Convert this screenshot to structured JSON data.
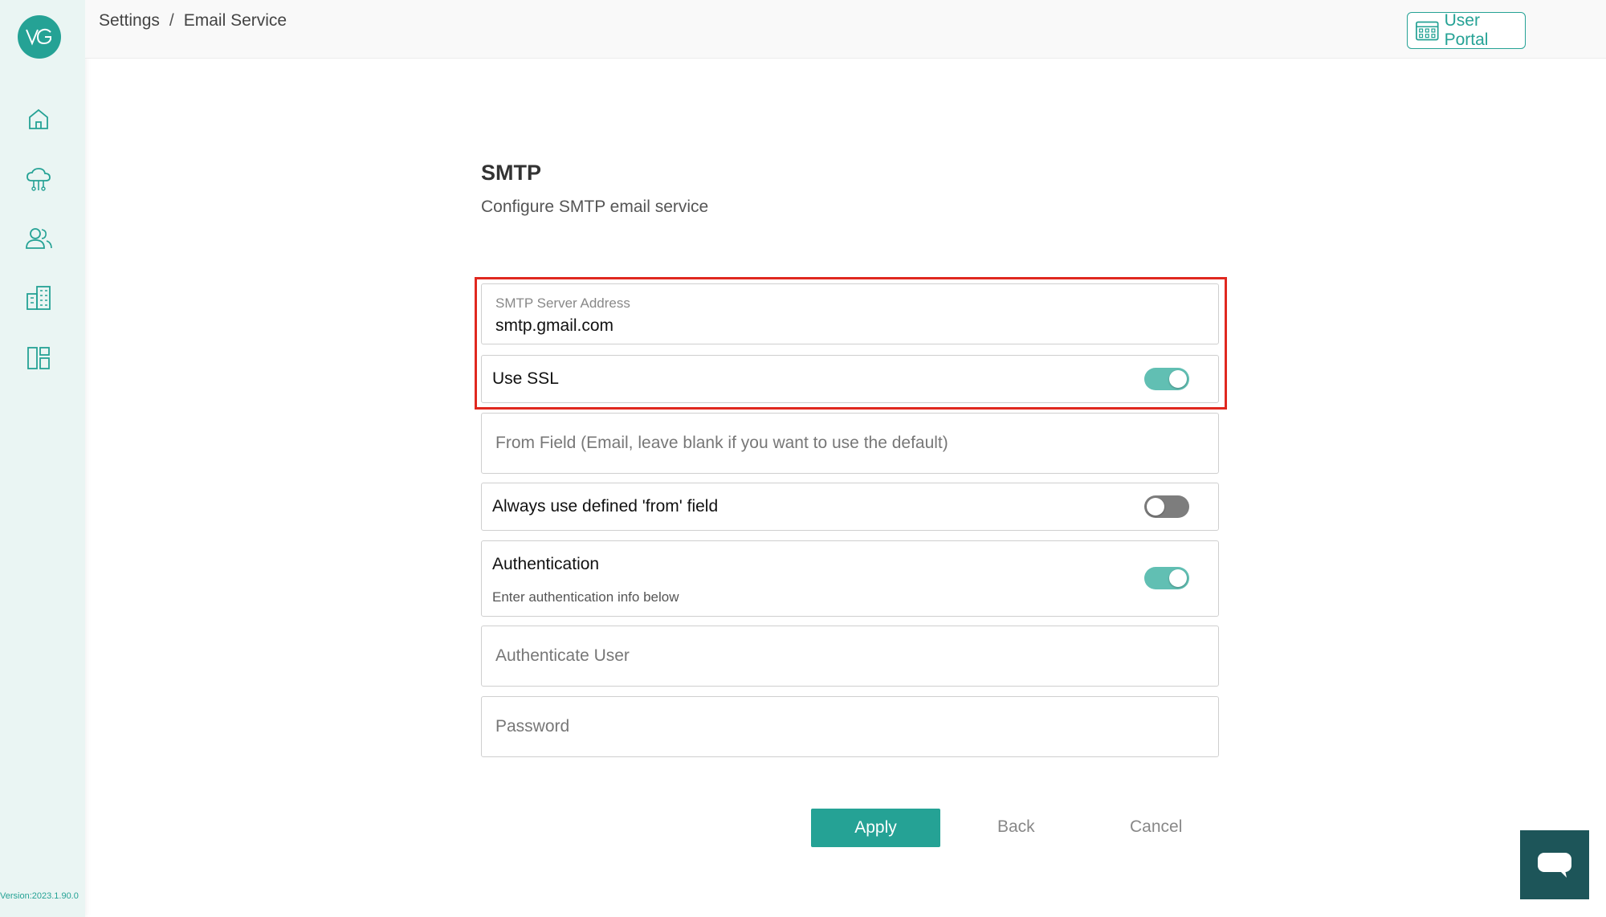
{
  "sidebar": {
    "logo_text": "VG",
    "nav_items": [
      {
        "name": "home",
        "icon": "home-icon"
      },
      {
        "name": "cloud-network",
        "icon": "cloud-network-icon"
      },
      {
        "name": "users",
        "icon": "users-icon"
      },
      {
        "name": "building",
        "icon": "building-icon"
      },
      {
        "name": "dashboard",
        "icon": "dashboard-layout-icon"
      }
    ],
    "version": "Version:2023.1.90.0"
  },
  "header": {
    "breadcrumb": [
      "Settings",
      "Email Service"
    ],
    "breadcrumb_separator": "/",
    "user_portal_label": "User Portal"
  },
  "main": {
    "title": "SMTP",
    "subtitle": "Configure SMTP email service",
    "smtp_server": {
      "label": "SMTP Server Address",
      "value": "smtp.gmail.com"
    },
    "use_ssl": {
      "label": "Use SSL",
      "on": true
    },
    "from_field": {
      "placeholder": "From Field (Email, leave blank if you want to use the default)",
      "value": ""
    },
    "always_use_from": {
      "label": "Always use defined 'from' field",
      "on": false
    },
    "authentication": {
      "label": "Authentication",
      "sublabel": "Enter authentication info below",
      "on": true
    },
    "auth_user": {
      "placeholder": "Authenticate User",
      "value": ""
    },
    "password": {
      "placeholder": "Password",
      "value": ""
    }
  },
  "actions": {
    "apply": "Apply",
    "back": "Back",
    "cancel": "Cancel"
  },
  "colors": {
    "accent": "#25a295",
    "toggle_on": "#61bfb3",
    "toggle_off": "#7d7d7d",
    "highlight": "#e0281f",
    "chat_button": "#1d5559"
  }
}
